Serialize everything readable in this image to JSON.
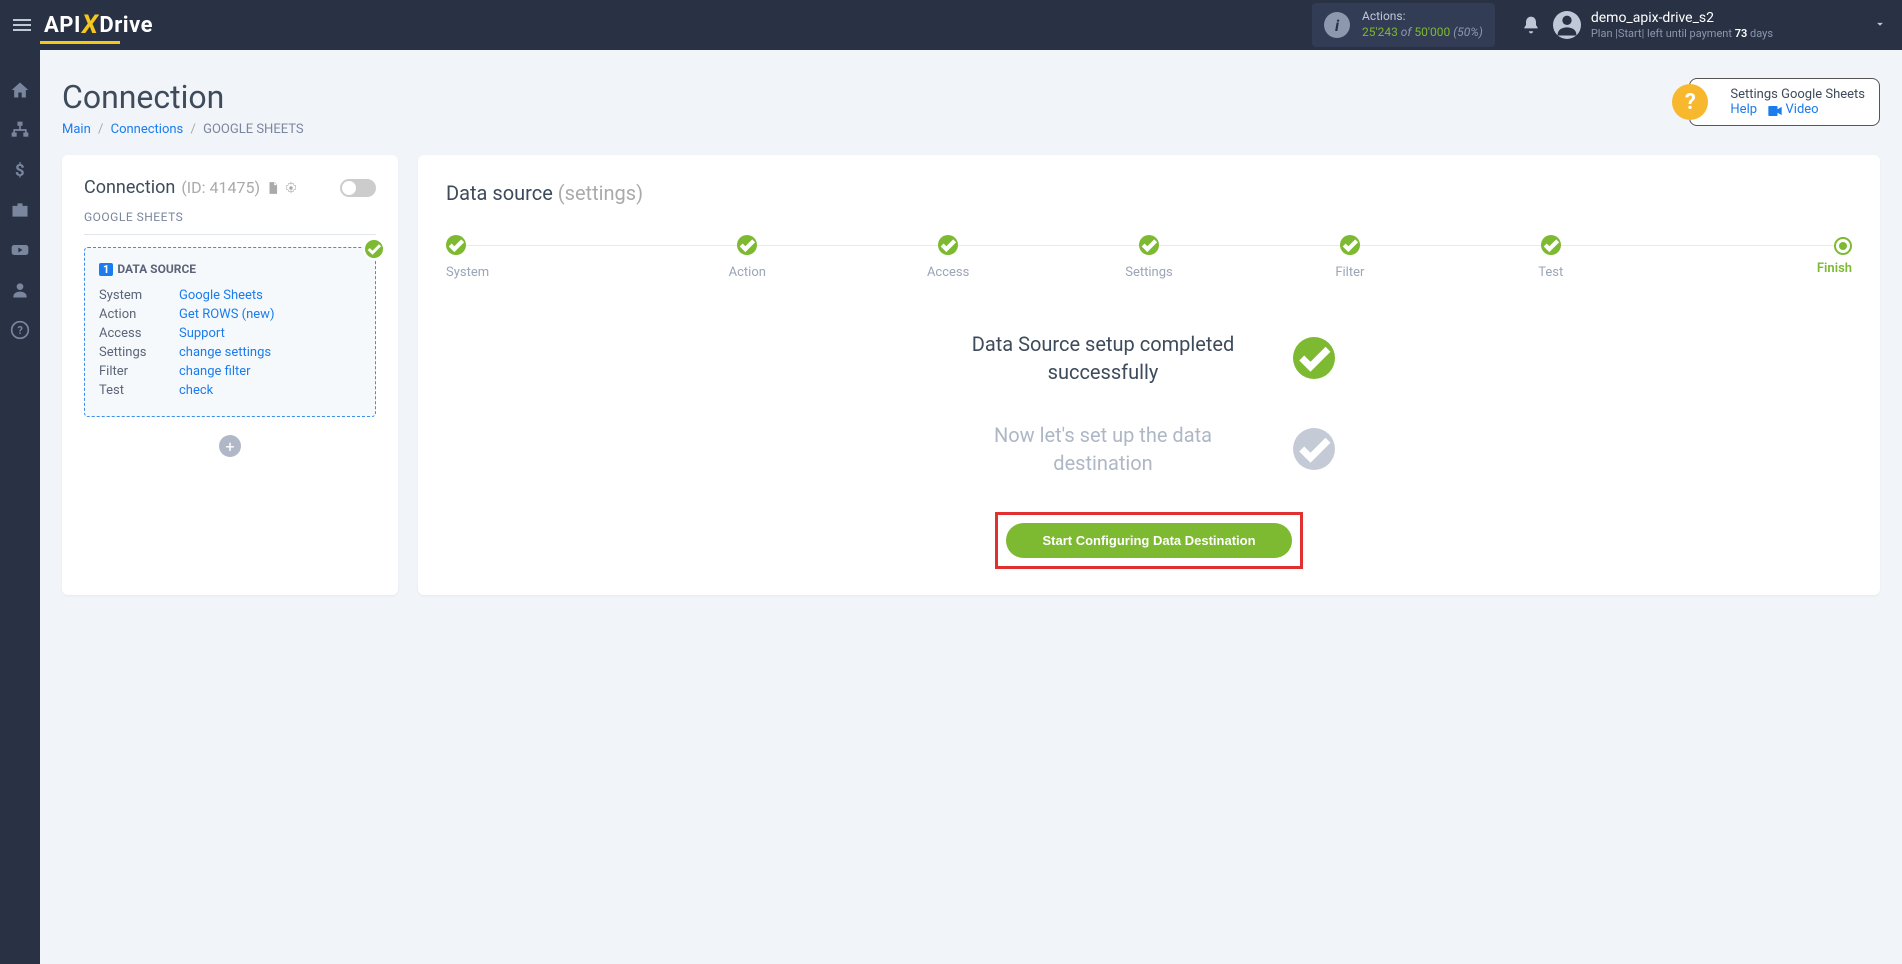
{
  "header": {
    "logo_api": "API",
    "logo_drive": "Drive",
    "actions_label": "Actions:",
    "actions_count": "25'243",
    "actions_of": " of ",
    "actions_total": "50'000",
    "actions_pct": " (50%)",
    "user_name": "demo_apix-drive_s2",
    "plan_prefix": "Plan |Start| left until payment ",
    "plan_days": "73",
    "plan_suffix": " days"
  },
  "page": {
    "title": "Connection",
    "breadcrumb_main": "Main",
    "breadcrumb_connections": "Connections",
    "breadcrumb_current": "GOOGLE SHEETS"
  },
  "helpbox": {
    "title": "Settings Google Sheets",
    "help_link": "Help",
    "video_link": "Video"
  },
  "left_card": {
    "title": "Connection",
    "id_text": "(ID: 41475)",
    "subtitle": "GOOGLE SHEETS",
    "ds_number": "1",
    "ds_title": "DATA SOURCE",
    "rows": [
      {
        "label": "System",
        "value": "Google Sheets"
      },
      {
        "label": "Action",
        "value": "Get ROWS (new)"
      },
      {
        "label": "Access",
        "value": "Support"
      },
      {
        "label": "Settings",
        "value": "change settings"
      },
      {
        "label": "Filter",
        "value": "change filter"
      },
      {
        "label": "Test",
        "value": "check"
      }
    ]
  },
  "right_card": {
    "title_main": "Data source ",
    "title_settings": "(settings)",
    "steps": [
      "System",
      "Action",
      "Access",
      "Settings",
      "Filter",
      "Test",
      "Finish"
    ],
    "status_done": "Data Source setup completed successfully",
    "status_next": "Now let's set up the data destination",
    "cta": "Start Configuring Data Destination"
  }
}
